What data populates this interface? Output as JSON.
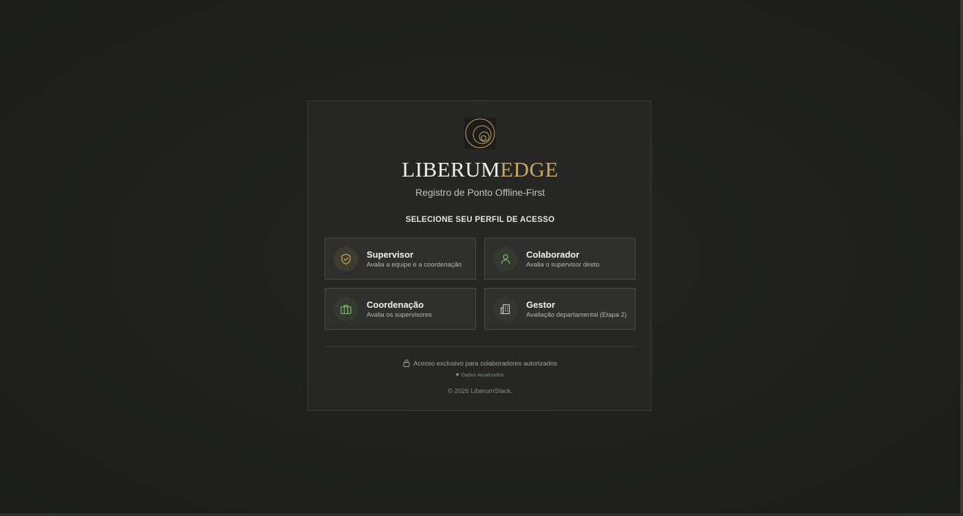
{
  "brand": {
    "name_part1": "LIBERUM",
    "name_part2": "EDGE",
    "subtitle": "Registro de Ponto Offline-First",
    "logo_icon": "spiral-logo-icon"
  },
  "selection": {
    "label": "SELECIONE SEU PERFIL DE ACESSO"
  },
  "roles": [
    {
      "title": "Supervisor",
      "description": "Avalia a equipe e a coordenação",
      "icon": "shield-check-icon",
      "accent": "#c7a860"
    },
    {
      "title": "Colaborador",
      "description": "Avalia o supervisor direto",
      "icon": "user-icon",
      "accent": "#7fae6e"
    },
    {
      "title": "Coordenação",
      "description": "Avalia os supervisores",
      "icon": "briefcase-icon",
      "accent": "#7fae6e"
    },
    {
      "title": "Gestor",
      "description": "Avaliação departamental (Etapa 2)",
      "icon": "building-icon",
      "accent": "#c9c8c2"
    }
  ],
  "footer": {
    "notice": "Acesso exclusivo para colaboradores autorizados",
    "status": "Dados Atualizados",
    "copyright": "© 2026 LiberumStack."
  },
  "colors": {
    "background": "#1f201d",
    "card": "#262724",
    "gold": "#c7a860",
    "green": "#7fae6e"
  }
}
